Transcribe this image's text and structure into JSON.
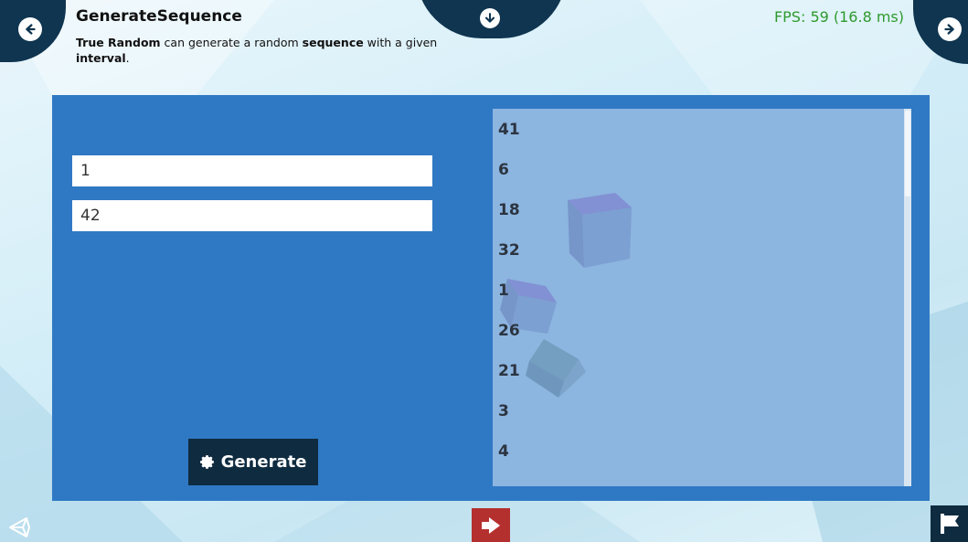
{
  "header": {
    "title": "GenerateSequence",
    "desc_bold1": "True Random",
    "desc_text1": " can generate a random ",
    "desc_bold2": "sequence",
    "desc_text2": " with a given ",
    "desc_bold3": "interval",
    "desc_text3": ".",
    "fps": "FPS: 59 (16.8 ms)"
  },
  "nav": {
    "prev_icon": "arrow-left-circle-icon",
    "next_icon": "arrow-right-circle-icon",
    "down_icon": "arrow-down-circle-icon"
  },
  "form": {
    "min_value": "1",
    "max_value": "42",
    "generate_label": "Generate",
    "generate_icon": "gear-icon"
  },
  "results": {
    "values": [
      "41",
      "6",
      "18",
      "32",
      "1",
      "26",
      "21",
      "3",
      "4"
    ]
  },
  "footer": {
    "unity_icon": "unity-logo-icon",
    "exit_icon": "exit-icon",
    "flag_icon": "flag-icon"
  },
  "colors": {
    "panel": "#2f79c4",
    "result_bg": "#8cb5e0",
    "dark": "#0f2b40",
    "fps": "#2e9a2e",
    "exit": "#b4302e"
  }
}
